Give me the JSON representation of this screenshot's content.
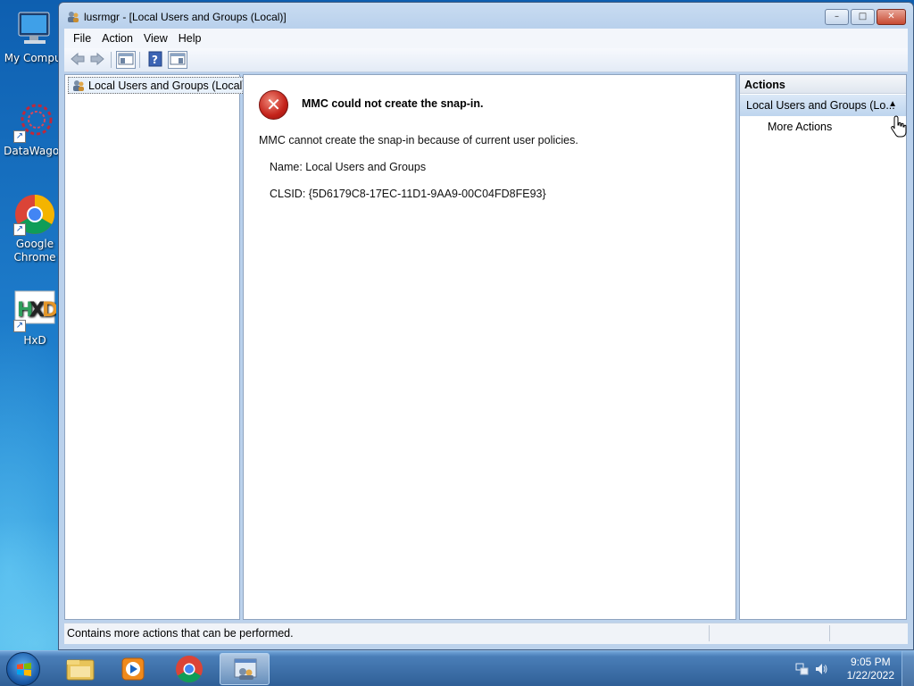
{
  "desktop": {
    "icons": [
      {
        "label": "My Comput",
        "icon": "computer-icon"
      },
      {
        "label": "DataWagon",
        "icon": "datawagon-icon"
      },
      {
        "label": "Google",
        "label2": "Chrome",
        "icon": "chrome-icon"
      },
      {
        "label": "HxD",
        "icon": "hxd-icon"
      }
    ]
  },
  "window": {
    "title": "lusrmgr - [Local Users and Groups (Local)]",
    "buttons": {
      "minimize": "–",
      "maximize": "□",
      "close": "✕"
    },
    "menu": [
      "File",
      "Action",
      "View",
      "Help"
    ],
    "toolbar": [
      "back-arrow-icon",
      "forward-arrow-icon",
      "show-hide-tree-icon",
      "help-icon",
      "show-hide-action-pane-icon"
    ]
  },
  "tree": {
    "root": "Local Users and Groups (Local)"
  },
  "content": {
    "error_title": "MMC could not create the snap-in.",
    "message": "MMC cannot create the snap-in because of current user policies.",
    "name_line": "Name: Local Users and Groups",
    "clsid_line": "CLSID: {5D6179C8-17EC-11D1-9AA9-00C04FD8FE93}"
  },
  "actions": {
    "header": "Actions",
    "group": "Local Users and Groups (Lo...",
    "items": [
      "More Actions"
    ]
  },
  "status": {
    "text": "Contains more actions that can be performed."
  },
  "taskbar": {
    "apps": [
      "explorer-icon",
      "media-player-icon",
      "chrome-icon",
      "mmc-icon"
    ],
    "time": "9:05 PM",
    "date": "1/22/2022"
  },
  "colors": {
    "accent": "#1c79c8",
    "error": "#c4221a",
    "action_group": "#bed5ee"
  }
}
